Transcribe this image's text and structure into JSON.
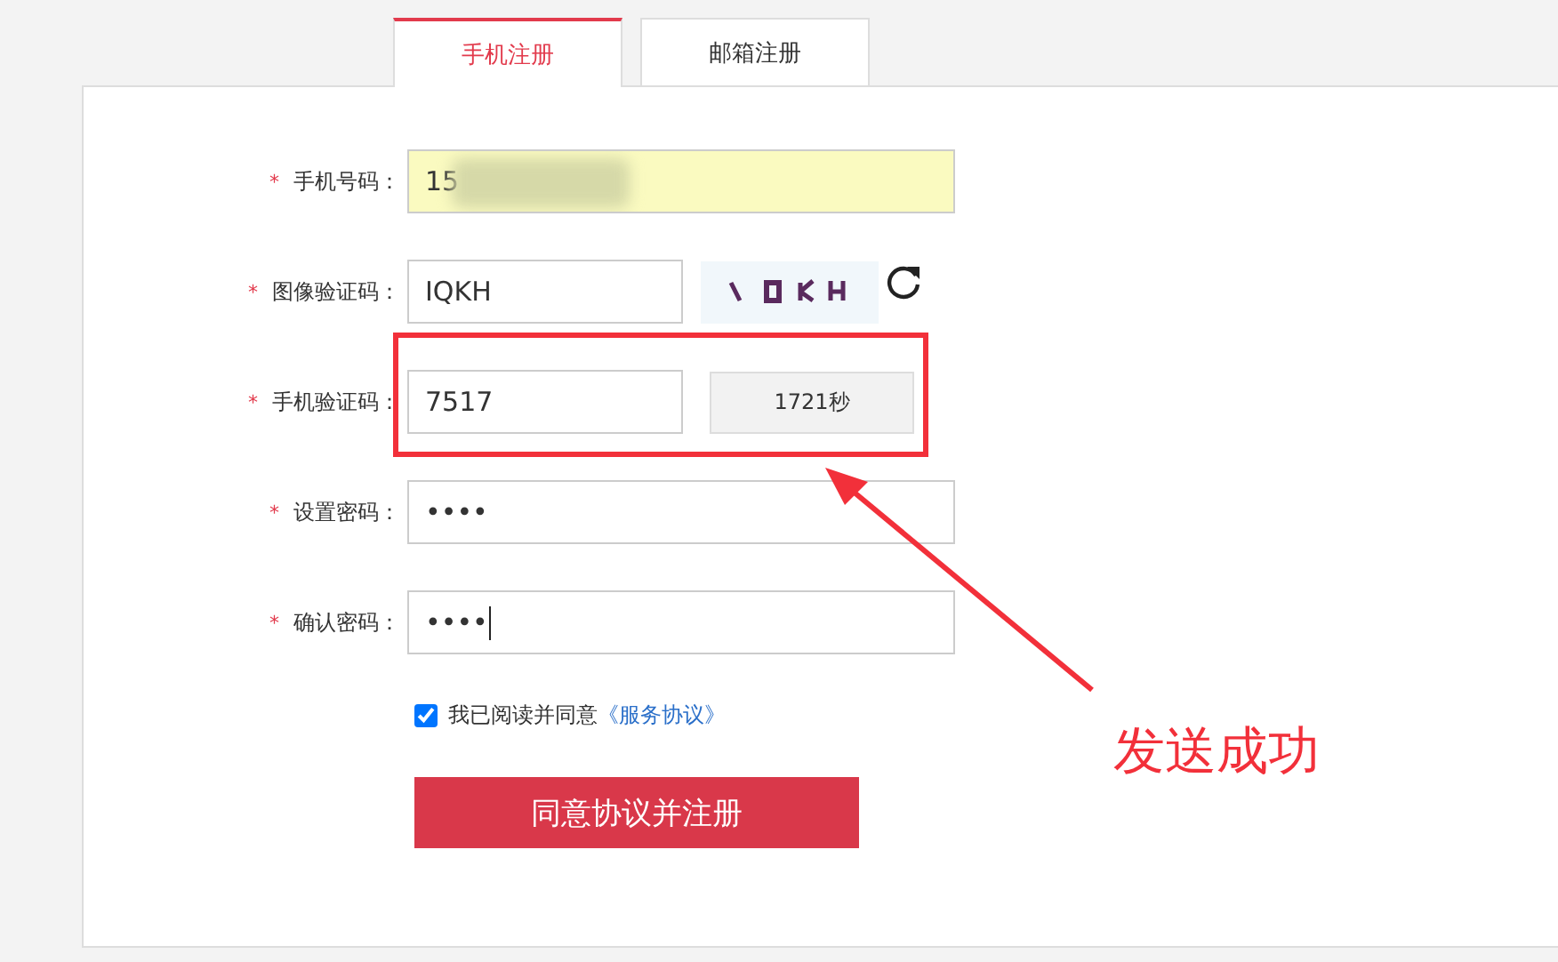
{
  "tabs": [
    {
      "label": "手机注册",
      "selected": true
    },
    {
      "label": "邮箱注册",
      "selected": false
    }
  ],
  "form": {
    "fields": [
      {
        "kind": "phone",
        "required_mark": "*",
        "label": "手机号码：",
        "value": "15",
        "autofilled": true,
        "redacted": true
      },
      {
        "kind": "captcha",
        "required_mark": "*",
        "label": "图像验证码：",
        "value": "IQKH"
      },
      {
        "kind": "sms",
        "required_mark": "*",
        "label": "手机验证码：",
        "value": "7517",
        "button": "1721秒"
      },
      {
        "kind": "password",
        "required_mark": "*",
        "label": "设置密码：",
        "value": "••••"
      },
      {
        "kind": "password",
        "required_mark": "*",
        "label": "确认密码：",
        "value": "••••",
        "focused": true
      }
    ],
    "agreement": {
      "checked": true,
      "text": "我已阅读并同意",
      "link": "《服务协议》"
    },
    "submit": "同意协议并注册"
  },
  "annotation": {
    "text": "发送成功"
  }
}
